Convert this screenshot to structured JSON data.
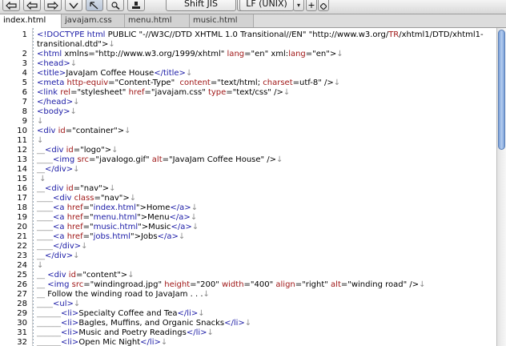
{
  "toolbar": {
    "encoding": "Shift JIS",
    "line_ending": "LF (UNIX)",
    "plus": "+",
    "arrow": "▾"
  },
  "tabs": [
    {
      "label": "index.html",
      "active": true
    },
    {
      "label": "javajam.css",
      "active": false
    },
    {
      "label": "menu.html",
      "active": false
    },
    {
      "label": "music.html",
      "active": false
    }
  ],
  "editor": {
    "lines": [
      {
        "num": "1",
        "segments": [
          [
            "tag",
            "<!DOCTYPE html "
          ],
          [
            "txt",
            "PUBLIC \"-//W3C//DTD XHTML 1.0 Transitional//EN\" \"http://www.w3.org/"
          ],
          [
            "attr",
            "TR"
          ],
          [
            "txt",
            "/xhtml1/DTD/xhtml1-"
          ]
        ]
      },
      {
        "num": "",
        "segments": [
          [
            "txt",
            "transitional.dtd\">"
          ],
          [
            "mark",
            "↓"
          ]
        ]
      },
      {
        "num": "2",
        "segments": [
          [
            "tag",
            "<html "
          ],
          [
            "txt",
            "xmlns=\"http://www.w3.org/1999/xhtml\" "
          ],
          [
            "attr",
            "lang"
          ],
          [
            "txt",
            "=\"en\" xml:"
          ],
          [
            "attr",
            "lang"
          ],
          [
            "txt",
            "=\"en\">"
          ],
          [
            "mark",
            "↓"
          ]
        ]
      },
      {
        "num": "3",
        "segments": [
          [
            "tag",
            "<head>"
          ],
          [
            "mark",
            "↓"
          ]
        ]
      },
      {
        "num": "4",
        "segments": [
          [
            "tag",
            "<title>"
          ],
          [
            "txt",
            "JavaJam Coffee House"
          ],
          [
            "tag",
            "</title>"
          ],
          [
            "mark",
            "↓"
          ]
        ]
      },
      {
        "num": "5",
        "segments": [
          [
            "tag",
            "<meta "
          ],
          [
            "attr",
            "http-equiv"
          ],
          [
            "txt",
            "=\"Content-Type\"  "
          ],
          [
            "attr",
            "content"
          ],
          [
            "txt",
            "=\"text/html; "
          ],
          [
            "attr",
            "charset"
          ],
          [
            "txt",
            "=utf-8\" />"
          ],
          [
            "mark",
            "↓"
          ]
        ]
      },
      {
        "num": "6",
        "segments": [
          [
            "tag",
            "<link "
          ],
          [
            "attr",
            "rel"
          ],
          [
            "txt",
            "=\"stylesheet\" "
          ],
          [
            "attr",
            "href"
          ],
          [
            "txt",
            "=\"javajam.css\" "
          ],
          [
            "attr",
            "type"
          ],
          [
            "txt",
            "=\"text/css\" />"
          ],
          [
            "mark",
            "↓"
          ]
        ]
      },
      {
        "num": "7",
        "segments": [
          [
            "tag",
            "</head>"
          ],
          [
            "mark",
            "↓"
          ]
        ]
      },
      {
        "num": "8",
        "segments": [
          [
            "tag",
            "<body>"
          ],
          [
            "mark",
            "↓"
          ]
        ]
      },
      {
        "num": "9",
        "segments": [
          [
            "mark",
            "↓"
          ]
        ]
      },
      {
        "num": "10",
        "segments": [
          [
            "tag",
            "<div "
          ],
          [
            "attr",
            "id"
          ],
          [
            "txt",
            "=\"container\">"
          ],
          [
            "mark",
            "↓"
          ]
        ]
      },
      {
        "num": "11",
        "segments": [
          [
            "mark",
            "↓"
          ]
        ]
      },
      {
        "num": "12",
        "segments": [
          [
            "mark",
            "__"
          ],
          [
            "tag",
            "<div "
          ],
          [
            "attr",
            "id"
          ],
          [
            "txt",
            "=\"logo\">"
          ],
          [
            "mark",
            "↓"
          ]
        ]
      },
      {
        "num": "13",
        "segments": [
          [
            "mark",
            "____"
          ],
          [
            "tag",
            "<img "
          ],
          [
            "attr",
            "src"
          ],
          [
            "txt",
            "=\"javalogo.gif\" "
          ],
          [
            "attr",
            "alt"
          ],
          [
            "txt",
            "=\"JavaJam Coffee House\" />"
          ],
          [
            "mark",
            "↓"
          ]
        ]
      },
      {
        "num": "14",
        "segments": [
          [
            "mark",
            "__"
          ],
          [
            "tag",
            "</div>"
          ],
          [
            "mark",
            "↓"
          ]
        ]
      },
      {
        "num": "15",
        "segments": [
          [
            "mark",
            " ↓"
          ]
        ]
      },
      {
        "num": "16",
        "segments": [
          [
            "mark",
            "__"
          ],
          [
            "tag",
            "<div "
          ],
          [
            "attr",
            "id"
          ],
          [
            "txt",
            "=\"nav\">"
          ],
          [
            "mark",
            "↓"
          ]
        ]
      },
      {
        "num": "17",
        "segments": [
          [
            "mark",
            "____"
          ],
          [
            "tag",
            "<div "
          ],
          [
            "attr",
            "class"
          ],
          [
            "txt",
            "=\"nav\">"
          ],
          [
            "mark",
            "↓"
          ]
        ]
      },
      {
        "num": "18",
        "segments": [
          [
            "mark",
            "____"
          ],
          [
            "tag",
            "<a "
          ],
          [
            "attr",
            "href"
          ],
          [
            "txt",
            "=\""
          ],
          [
            "tag",
            "index.html"
          ],
          [
            "txt",
            "\">Home"
          ],
          [
            "tag",
            "</a>"
          ],
          [
            "mark",
            "↓"
          ]
        ]
      },
      {
        "num": "19",
        "segments": [
          [
            "mark",
            "____"
          ],
          [
            "tag",
            "<a "
          ],
          [
            "attr",
            "href"
          ],
          [
            "txt",
            "=\""
          ],
          [
            "tag",
            "menu.html"
          ],
          [
            "txt",
            "\">Menu"
          ],
          [
            "tag",
            "</a>"
          ],
          [
            "mark",
            "↓"
          ]
        ]
      },
      {
        "num": "20",
        "segments": [
          [
            "mark",
            "____"
          ],
          [
            "tag",
            "<a "
          ],
          [
            "attr",
            "href"
          ],
          [
            "txt",
            "=\""
          ],
          [
            "tag",
            "music.html"
          ],
          [
            "txt",
            "\">Music"
          ],
          [
            "tag",
            "</a>"
          ],
          [
            "mark",
            "↓"
          ]
        ]
      },
      {
        "num": "21",
        "segments": [
          [
            "mark",
            "____"
          ],
          [
            "tag",
            "<a "
          ],
          [
            "attr",
            "href"
          ],
          [
            "txt",
            "=\""
          ],
          [
            "tag",
            "jobs.html"
          ],
          [
            "txt",
            "\">Jobs"
          ],
          [
            "tag",
            "</a>"
          ],
          [
            "mark",
            "↓"
          ]
        ]
      },
      {
        "num": "22",
        "segments": [
          [
            "mark",
            "____"
          ],
          [
            "tag",
            "</div>"
          ],
          [
            "mark",
            "↓"
          ]
        ]
      },
      {
        "num": "23",
        "segments": [
          [
            "mark",
            "__"
          ],
          [
            "tag",
            "</div>"
          ],
          [
            "mark",
            "↓"
          ]
        ]
      },
      {
        "num": "24",
        "segments": [
          [
            "mark",
            "↓"
          ]
        ]
      },
      {
        "num": "25",
        "segments": [
          [
            "mark",
            "__ "
          ],
          [
            "tag",
            "<div "
          ],
          [
            "attr",
            "id"
          ],
          [
            "txt",
            "=\"content\">"
          ],
          [
            "mark",
            "↓"
          ]
        ]
      },
      {
        "num": "26",
        "segments": [
          [
            "mark",
            "__ "
          ],
          [
            "tag",
            "<img "
          ],
          [
            "attr",
            "src"
          ],
          [
            "txt",
            "=\"windingroad.jpg\" "
          ],
          [
            "attr",
            "height"
          ],
          [
            "txt",
            "=\"200\" "
          ],
          [
            "attr",
            "width"
          ],
          [
            "txt",
            "=\"400\" "
          ],
          [
            "attr",
            "align"
          ],
          [
            "txt",
            "=\"right\" "
          ],
          [
            "attr",
            "alt"
          ],
          [
            "txt",
            "=\"winding road\" />"
          ],
          [
            "mark",
            "↓"
          ]
        ]
      },
      {
        "num": "27",
        "segments": [
          [
            "mark",
            "__ "
          ],
          [
            "txt",
            "Follow the winding road to JavaJam . . ."
          ],
          [
            "mark",
            "↓"
          ]
        ]
      },
      {
        "num": "28",
        "segments": [
          [
            "mark",
            "____"
          ],
          [
            "tag",
            "<ul>"
          ],
          [
            "mark",
            "↓"
          ]
        ]
      },
      {
        "num": "29",
        "segments": [
          [
            "mark",
            "______"
          ],
          [
            "tag",
            "<li>"
          ],
          [
            "txt",
            "Specialty Coffee and Tea"
          ],
          [
            "tag",
            "</li>"
          ],
          [
            "mark",
            "↓"
          ]
        ]
      },
      {
        "num": "30",
        "segments": [
          [
            "mark",
            "______"
          ],
          [
            "tag",
            "<li>"
          ],
          [
            "txt",
            "Bagles, Muffins, and Organic Snacks"
          ],
          [
            "tag",
            "</li>"
          ],
          [
            "mark",
            "↓"
          ]
        ]
      },
      {
        "num": "31",
        "segments": [
          [
            "mark",
            "______"
          ],
          [
            "tag",
            "<li>"
          ],
          [
            "txt",
            "Music and Poetry Readings"
          ],
          [
            "tag",
            "</li>"
          ],
          [
            "mark",
            "↓"
          ]
        ]
      },
      {
        "num": "32",
        "segments": [
          [
            "mark",
            "______"
          ],
          [
            "tag",
            "<li>"
          ],
          [
            "txt",
            "Open Mic Night"
          ],
          [
            "tag",
            "</li>"
          ],
          [
            "mark",
            "↓"
          ]
        ]
      }
    ]
  }
}
